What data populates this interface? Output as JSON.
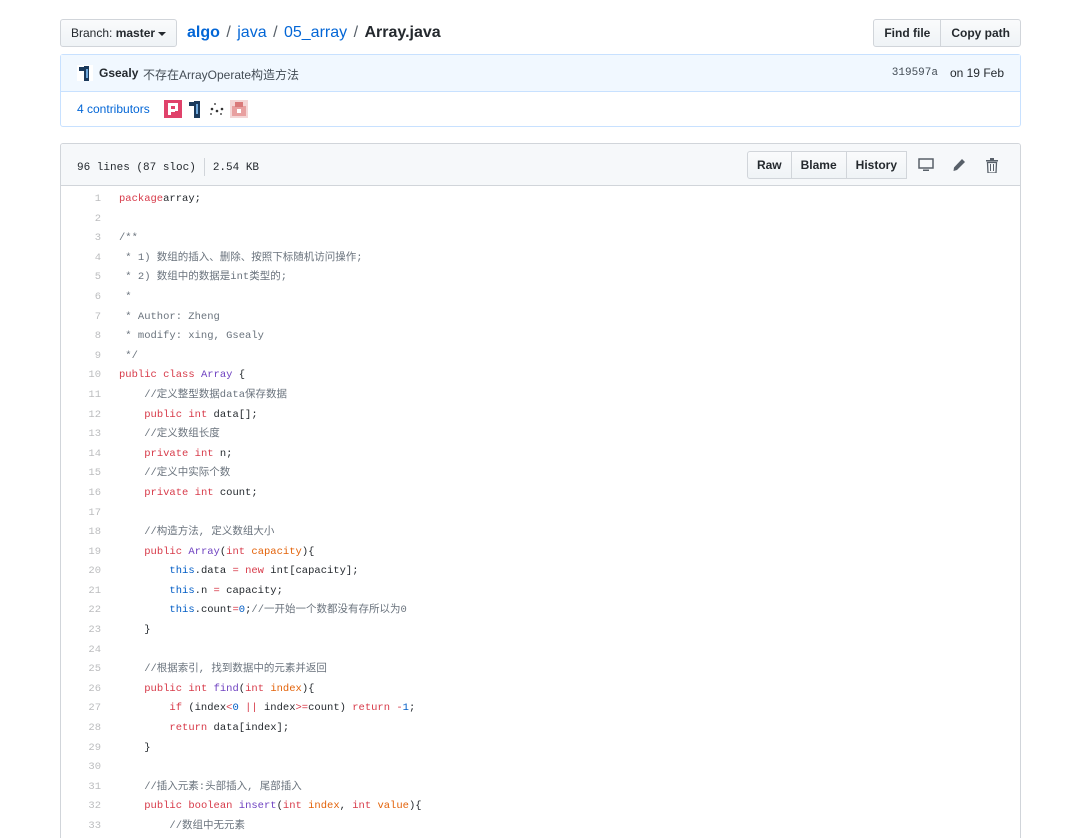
{
  "nav": {
    "branch_label": "Branch:",
    "branch_name": "master",
    "repo": "algo",
    "sep": "/",
    "dir1": "java",
    "dir2": "05_array",
    "file": "Array.java",
    "find_file": "Find file",
    "copy_path": "Copy path"
  },
  "commit": {
    "author": "Gsealy",
    "message": "不存在ArrayOperate构造方法",
    "sha": "319597a",
    "date": "on 19 Feb"
  },
  "contributors": {
    "label": "4 contributors"
  },
  "file": {
    "lines_info": "96 lines (87 sloc)",
    "size": "2.54 KB",
    "raw": "Raw",
    "blame": "Blame",
    "history": "History"
  },
  "colors": {
    "link": "#0366d6",
    "keyword": "#d73a49",
    "type": "#6f42c1",
    "comment": "#6a737d",
    "param": "#e36209",
    "builtin": "#005cc5"
  },
  "icons": [
    "caret-down-icon",
    "desktop-icon",
    "pencil-icon",
    "trashcan-icon"
  ],
  "code_lines": [
    [
      [
        "k",
        "package"
      ],
      [
        "",
        "array;"
      ]
    ],
    [],
    [
      [
        "c",
        "/**"
      ]
    ],
    [
      [
        "c",
        " * 1) 数组的插入、删除、按照下标随机访问操作;"
      ]
    ],
    [
      [
        "c",
        " * 2) 数组中的数据是int类型的;"
      ]
    ],
    [
      [
        "c",
        " *"
      ]
    ],
    [
      [
        "c",
        " * Author: Zheng"
      ]
    ],
    [
      [
        "c",
        " * modify: xing, Gsealy"
      ]
    ],
    [
      [
        "c",
        " */"
      ]
    ],
    [
      [
        "k",
        "public"
      ],
      [
        "",
        " "
      ],
      [
        "k",
        "class"
      ],
      [
        "",
        " "
      ],
      [
        "t",
        "Array"
      ],
      [
        "",
        " {"
      ]
    ],
    [
      [
        "c",
        "    //定义整型数据data保存数据"
      ]
    ],
    [
      [
        "",
        "    "
      ],
      [
        "k",
        "public"
      ],
      [
        "",
        " "
      ],
      [
        "k",
        "int"
      ],
      [
        "",
        " data[];"
      ]
    ],
    [
      [
        "c",
        "    //定义数组长度"
      ]
    ],
    [
      [
        "",
        "    "
      ],
      [
        "k",
        "private"
      ],
      [
        "",
        " "
      ],
      [
        "k",
        "int"
      ],
      [
        "",
        " n;"
      ]
    ],
    [
      [
        "c",
        "    //定义中实际个数"
      ]
    ],
    [
      [
        "",
        "    "
      ],
      [
        "k",
        "private"
      ],
      [
        "",
        " "
      ],
      [
        "k",
        "int"
      ],
      [
        "",
        " count;"
      ]
    ],
    [],
    [
      [
        "c",
        "    //构造方法, 定义数组大小"
      ]
    ],
    [
      [
        "",
        "    "
      ],
      [
        "k",
        "public"
      ],
      [
        "",
        " "
      ],
      [
        "t",
        "Array"
      ],
      [
        "",
        "("
      ],
      [
        "k",
        "int"
      ],
      [
        "",
        " "
      ],
      [
        "v",
        "capacity"
      ],
      [
        "",
        "){"
      ]
    ],
    [
      [
        "",
        "        "
      ],
      [
        "b",
        "this"
      ],
      [
        "",
        ".data "
      ],
      [
        "k",
        "="
      ],
      [
        "",
        " "
      ],
      [
        "k",
        "new"
      ],
      [
        "",
        " int[capacity];"
      ]
    ],
    [
      [
        "",
        "        "
      ],
      [
        "b",
        "this"
      ],
      [
        "",
        ".n "
      ],
      [
        "k",
        "="
      ],
      [
        "",
        " capacity;"
      ]
    ],
    [
      [
        "",
        "        "
      ],
      [
        "b",
        "this"
      ],
      [
        "",
        ".count"
      ],
      [
        "k",
        "="
      ],
      [
        "b",
        "0"
      ],
      [
        "",
        ";"
      ],
      [
        "c",
        "//一开始一个数都没有存所以为0"
      ]
    ],
    [
      [
        "",
        "    }"
      ]
    ],
    [],
    [
      [
        "c",
        "    //根据索引, 找到数据中的元素并返回"
      ]
    ],
    [
      [
        "",
        "    "
      ],
      [
        "k",
        "public"
      ],
      [
        "",
        " "
      ],
      [
        "k",
        "int"
      ],
      [
        "",
        " "
      ],
      [
        "t",
        "find"
      ],
      [
        "",
        "("
      ],
      [
        "k",
        "int"
      ],
      [
        "",
        " "
      ],
      [
        "v",
        "index"
      ],
      [
        "",
        "){"
      ]
    ],
    [
      [
        "",
        "        "
      ],
      [
        "k",
        "if"
      ],
      [
        "",
        " (index"
      ],
      [
        "k",
        "<"
      ],
      [
        "b",
        "0"
      ],
      [
        "",
        " "
      ],
      [
        "k",
        "||"
      ],
      [
        "",
        " index"
      ],
      [
        "k",
        ">="
      ],
      [
        "",
        "count) "
      ],
      [
        "k",
        "return"
      ],
      [
        "",
        " "
      ],
      [
        "k",
        "-"
      ],
      [
        "b",
        "1"
      ],
      [
        "",
        ";"
      ]
    ],
    [
      [
        "",
        "        "
      ],
      [
        "k",
        "return"
      ],
      [
        "",
        " data[index];"
      ]
    ],
    [
      [
        "",
        "    }"
      ]
    ],
    [],
    [
      [
        "c",
        "    //插入元素:头部插入, 尾部插入"
      ]
    ],
    [
      [
        "",
        "    "
      ],
      [
        "k",
        "public"
      ],
      [
        "",
        " "
      ],
      [
        "k",
        "boolean"
      ],
      [
        "",
        " "
      ],
      [
        "t",
        "insert"
      ],
      [
        "",
        "("
      ],
      [
        "k",
        "int"
      ],
      [
        "",
        " "
      ],
      [
        "v",
        "index"
      ],
      [
        "",
        ", "
      ],
      [
        "k",
        "int"
      ],
      [
        "",
        " "
      ],
      [
        "v",
        "value"
      ],
      [
        "",
        "){"
      ]
    ],
    [
      [
        "c",
        "        //数组中无元素"
      ]
    ]
  ]
}
